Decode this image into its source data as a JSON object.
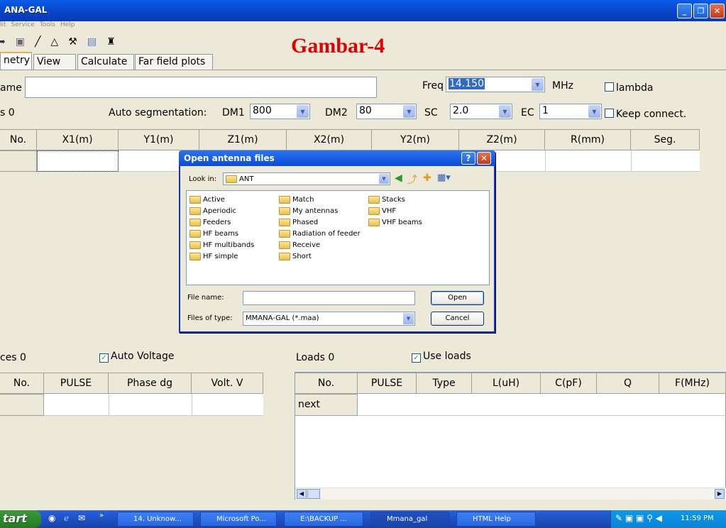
{
  "window": {
    "title": "ANA-GAL",
    "minimize": "_",
    "maximize": "❐",
    "close": "✕"
  },
  "menu": [
    "lit",
    "Service",
    "Tools",
    "Help"
  ],
  "toolbar_icons": [
    "open-icon",
    "save-icon",
    "line-icon",
    "triangle-icon",
    "tools-icon",
    "notes-icon",
    "antenna-icon"
  ],
  "overlay_title": "Gambar-4",
  "tabs": [
    "netry",
    "View",
    "Calculate",
    "Far field plots"
  ],
  "geometry": {
    "name_label": "ame",
    "wires_label": "s 0",
    "freq_label": "Freq",
    "freq_value": "14.150",
    "freq_unit": "MHz",
    "lambda_label": "lambda",
    "auto_seg_label": "Auto segmentation:",
    "dm1_label": "DM1",
    "dm1_value": "800",
    "dm2_label": "DM2",
    "dm2_value": "80",
    "sc_label": "SC",
    "sc_value": "2.0",
    "ec_label": "EC",
    "ec_value": "1",
    "keep_connect_label": "Keep connect.",
    "columns": [
      "No.",
      "X1(m)",
      "Y1(m)",
      "Z1(m)",
      "X2(m)",
      "Y2(m)",
      "Z2(m)",
      "R(mm)",
      "Seg."
    ]
  },
  "sources": {
    "label": "ces 0",
    "auto_voltage": "Auto Voltage",
    "columns": [
      "No.",
      "PULSE",
      "Phase dg",
      "Volt. V"
    ]
  },
  "loads": {
    "label": "Loads 0",
    "use_loads": "Use loads",
    "columns": [
      "No.",
      "PULSE",
      "Type",
      "L(uH)",
      "C(pF)",
      "Q",
      "F(MHz)"
    ],
    "first_row": "next"
  },
  "dialog": {
    "title": "Open antenna files",
    "help": "?",
    "close": "✕",
    "look_in_label": "Look in:",
    "look_in_value": "ANT",
    "folders": [
      [
        "Active",
        "Aperiodic",
        "Feeders",
        "HF beams",
        "HF multibands",
        "HF simple"
      ],
      [
        "Match",
        "My antennas",
        "Phased",
        "Radiation of feeder",
        "Receive",
        "Short"
      ],
      [
        "Stacks",
        "VHF",
        "VHF beams"
      ]
    ],
    "file_name_label": "File name:",
    "file_name_value": "",
    "files_of_type_label": "Files of type:",
    "files_of_type_value": "MMANA-GAL (*.maa)",
    "open_button": "Open",
    "cancel_button": "Cancel"
  },
  "taskbar": {
    "start": "tart",
    "items": [
      "14. Unknow...",
      "Microsoft Po...",
      "E:\\BACKUP ...",
      "Mmana_gal",
      "HTML Help"
    ],
    "clock": "11:59 PM"
  }
}
